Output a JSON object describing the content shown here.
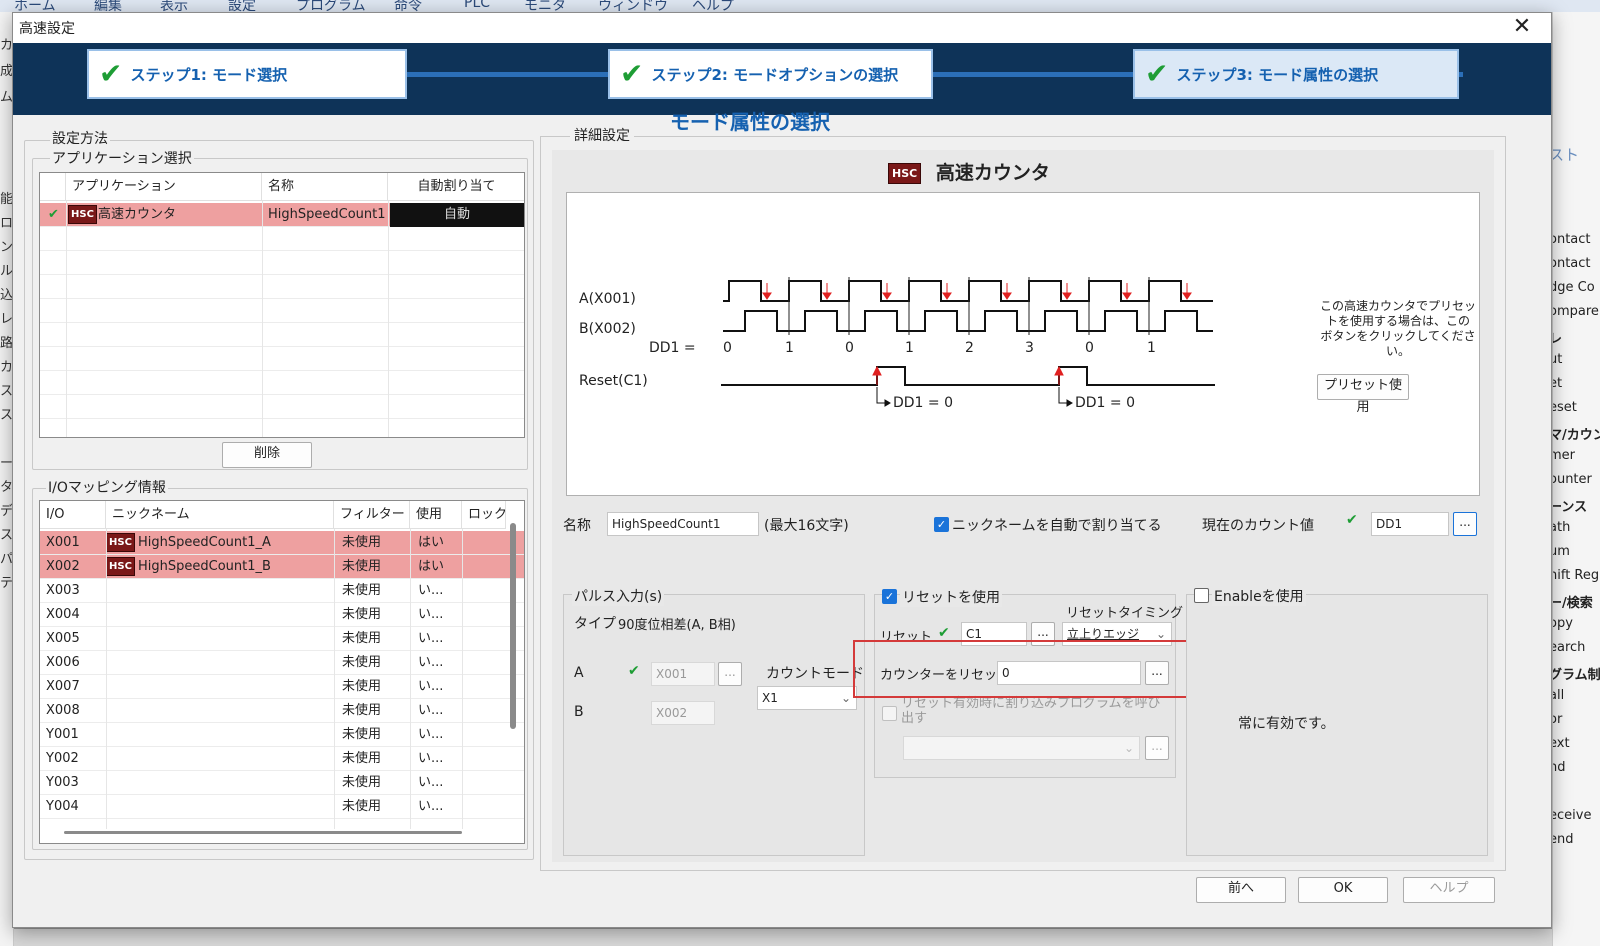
{
  "background_app": {
    "menu_items": [
      "ホーム",
      "編集",
      "表示",
      "設定",
      "プログラム",
      "命令",
      "PLC",
      "モニタ",
      "ウィンドウ",
      "ヘルプ"
    ],
    "left_fragments": [
      "カ",
      "成",
      "ム",
      "能",
      "ロ",
      "ン",
      "ル",
      "込",
      "レ",
      "路",
      "カ",
      "ス",
      "ス",
      "ー",
      "タ",
      "デ",
      "ス",
      "パ",
      "テ"
    ],
    "right_fragments": [
      "スト",
      "ontact",
      "ontact",
      "dge Co",
      "ompare",
      "レ",
      "ut",
      "et",
      "eset",
      "マ/カウン",
      "mer",
      "ounter",
      "ーンス",
      "ath",
      "um",
      "hift Reg",
      "ー/検索",
      "opy",
      "earch",
      "グラム制",
      "all",
      "or",
      "ext",
      "nd",
      "eceive",
      "end"
    ]
  },
  "dialog": {
    "title": "高速設定",
    "close_label": "✕",
    "steps": [
      {
        "label": "ステップ1: モード選択"
      },
      {
        "label": "ステップ2: モードオプションの選択"
      },
      {
        "label": "ステップ3: モード属性の選択"
      }
    ],
    "heading": "モード属性の選択"
  },
  "left": {
    "title": "設定方法",
    "app_group": "アプリケーション選択",
    "app_table": {
      "headers": [
        "アプリケーション",
        "名称",
        "自動割り当て"
      ],
      "rows": [
        {
          "check": "✔",
          "icon": "HSC",
          "app": "高速カウンタ",
          "name": "HighSpeedCount1",
          "auto": "自動"
        }
      ]
    },
    "delete_button": "削除",
    "io_group": "I/Oマッピング情報",
    "io_table": {
      "headers": [
        "I/O",
        "ニックネーム",
        "フィルター",
        "使用",
        "ロック"
      ],
      "rows": [
        {
          "io": "X001",
          "icon": "HSC",
          "nick": "HighSpeedCount1_A",
          "filter": "未使用",
          "use": "はい",
          "sel": true
        },
        {
          "io": "X002",
          "icon": "HSC",
          "nick": "HighSpeedCount1_B",
          "filter": "未使用",
          "use": "はい",
          "sel": true
        },
        {
          "io": "X003",
          "icon": "",
          "nick": "",
          "filter": "未使用",
          "use": "い...",
          "sel": false
        },
        {
          "io": "X004",
          "icon": "",
          "nick": "",
          "filter": "未使用",
          "use": "い...",
          "sel": false
        },
        {
          "io": "X005",
          "icon": "",
          "nick": "",
          "filter": "未使用",
          "use": "い...",
          "sel": false
        },
        {
          "io": "X006",
          "icon": "",
          "nick": "",
          "filter": "未使用",
          "use": "い...",
          "sel": false
        },
        {
          "io": "X007",
          "icon": "",
          "nick": "",
          "filter": "未使用",
          "use": "い...",
          "sel": false
        },
        {
          "io": "X008",
          "icon": "",
          "nick": "",
          "filter": "未使用",
          "use": "い...",
          "sel": false
        },
        {
          "io": "Y001",
          "icon": "",
          "nick": "",
          "filter": "未使用",
          "use": "い...",
          "sel": false
        },
        {
          "io": "Y002",
          "icon": "",
          "nick": "",
          "filter": "未使用",
          "use": "い...",
          "sel": false
        },
        {
          "io": "Y003",
          "icon": "",
          "nick": "",
          "filter": "未使用",
          "use": "い...",
          "sel": false
        },
        {
          "io": "Y004",
          "icon": "",
          "nick": "",
          "filter": "未使用",
          "use": "い...",
          "sel": false
        }
      ]
    }
  },
  "detail": {
    "group_title": "詳細設定",
    "hsc_icon": "HSC",
    "hsc_title": "高速カウンタ",
    "diagram": {
      "label_a": "A(X001)",
      "label_b": "B(X002)",
      "label_dd1": "DD1 =",
      "counts": [
        "0",
        "1",
        "0",
        "1",
        "2",
        "3",
        "0",
        "1"
      ],
      "label_reset": "Reset(C1)",
      "reset_note": "DD1 = 0",
      "preset_text": [
        "この高速カウンタでプリセッ",
        "トを使用する場合は、この",
        "ボタンをクリックしてください。"
      ],
      "preset_button": "プリセット使用"
    },
    "name_label": "名称",
    "name_value": "HighSpeedCount1",
    "name_max": "(最大16文字)",
    "auto_nick_label": "ニックネームを自動で割り当てる",
    "current_count_label": "現在のカウント値",
    "current_count_value": "DD1",
    "pulse": {
      "title": "パルス入力(s)",
      "type_label": "タイプ",
      "type_value": "90度位相差(A, B相)",
      "a_label": "A",
      "a_value": "X001",
      "b_label": "B",
      "b_value": "X002",
      "count_mode_label": "カウントモード",
      "count_mode_value": "X1"
    },
    "reset": {
      "use_label": "リセットを使用",
      "timing_label": "リセットタイミング",
      "reset_label": "リセット",
      "reset_value": "C1",
      "timing_value": "立上りエッジ",
      "counter_reset_label": "カウンターをリセット",
      "counter_reset_value": "0",
      "interrupt_label_1": "リセット有効時に割り込みプログラムを呼び",
      "interrupt_label_2": "出す"
    },
    "enable": {
      "label": "Enableを使用",
      "always": "常に有効です。"
    }
  },
  "buttons": {
    "back": "前へ",
    "ok": "OK",
    "help": "ヘルプ"
  },
  "ellipsis": "..."
}
